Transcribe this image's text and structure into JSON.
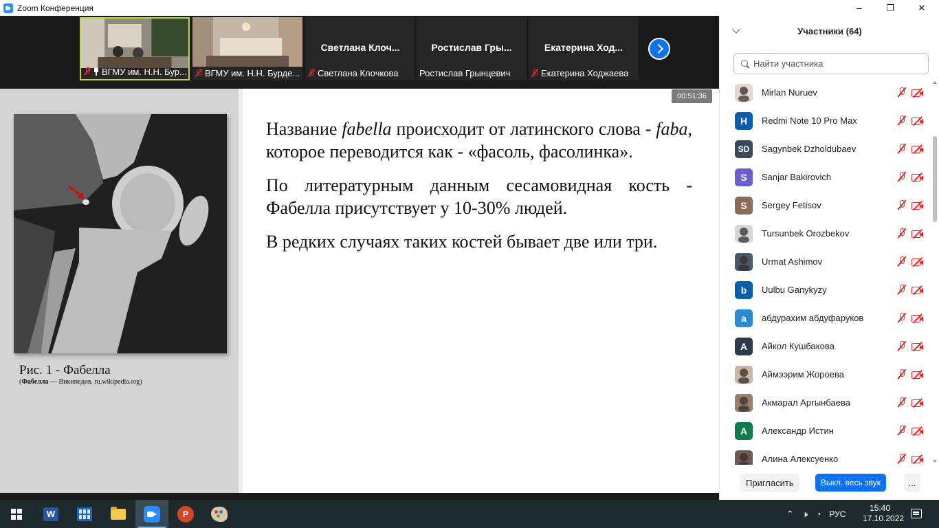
{
  "window": {
    "title": "Zoom Конференция",
    "minimize": "–",
    "restore": "❐",
    "close": "✕"
  },
  "video_tiles": [
    {
      "label": "ВГМУ им. Н.Н. Бур...",
      "type": "camera",
      "active": true
    },
    {
      "label": "ВГМУ им. Н.Н. Бурде...",
      "type": "camera",
      "active": false
    },
    {
      "label": "Светлана Клочкова",
      "big_name": "Светлана Клоч...",
      "type": "name"
    },
    {
      "label": "Ростислав Грынцевич",
      "big_name": "Ростислав Гры...",
      "type": "name"
    },
    {
      "label": "Екатерина Ходжаева",
      "big_name": "Екатерина Ход...",
      "type": "name"
    }
  ],
  "share": {
    "timer": "00:51:36",
    "caption": "Рис. 1 - Фабелла",
    "caption_source_bold": "Фабелла",
    "caption_source_rest": " — Википедия, ru.wikipedia.org)",
    "caption_source_open": "(",
    "paragraphs": [
      {
        "a": "Название ",
        "i1": "fabella",
        "b": " происходит от латинского слова - ",
        "i2": "faba",
        "c": ", которое переводится как - «фасоль, фасолинка»."
      },
      {
        "text": "По литературным данным сесамовидная кость - Фабелла  присутствует у 10-30% людей."
      },
      {
        "text": "В редких случаях таких костей бывает две или три."
      }
    ]
  },
  "participants_panel": {
    "title": "Участники (64)",
    "search_placeholder": "Найти участника",
    "items": [
      {
        "name": "Mirlan Nuruev",
        "avatar": "",
        "color": "#e8d9d0",
        "photo": true
      },
      {
        "name": "Redmi Note 10 Pro Max",
        "avatar": "H",
        "color": "#0b5cad"
      },
      {
        "name": "Sagynbek Dzholdubaev",
        "avatar": "SD",
        "color": "#3a4a5c"
      },
      {
        "name": "Sanjar Bakirovich",
        "avatar": "S",
        "color": "#6b5fcf"
      },
      {
        "name": "Sergey Fetisov",
        "avatar": "S",
        "color": "#8a6a58"
      },
      {
        "name": "Tursunbek Orozbekov",
        "avatar": "",
        "color": "#d7d7d7",
        "photo": true
      },
      {
        "name": "Urmat Ashimov",
        "avatar": "",
        "color": "#4a5a6b",
        "photo": true
      },
      {
        "name": "Uulbu Ganykyzy",
        "avatar": "b",
        "color": "#0b5cad"
      },
      {
        "name": "абдурахим абдуфаруков",
        "avatar": "a",
        "color": "#2a8ad6"
      },
      {
        "name": "Айкол Кушбакова",
        "avatar": "А",
        "color": "#2f3b4a"
      },
      {
        "name": "Аймээрим Жороева",
        "avatar": "",
        "color": "#c9b6a6",
        "photo": true
      },
      {
        "name": "Акмарал Аргынбаева",
        "avatar": "",
        "color": "#9a7d6b",
        "photo": true
      },
      {
        "name": "Александр Истин",
        "avatar": "А",
        "color": "#0f7a4a"
      },
      {
        "name": "Алина Алексуенко",
        "avatar": "",
        "color": "#6d5a52",
        "photo": true
      }
    ],
    "invite_label": "Пригласить",
    "mute_all_label": "Выкл. весь звук",
    "more_label": "..."
  },
  "taskbar": {
    "lang": "РУС",
    "time": "15:40",
    "date": "17.10.2022",
    "word_letter": "W",
    "ppt_letter": "P"
  }
}
